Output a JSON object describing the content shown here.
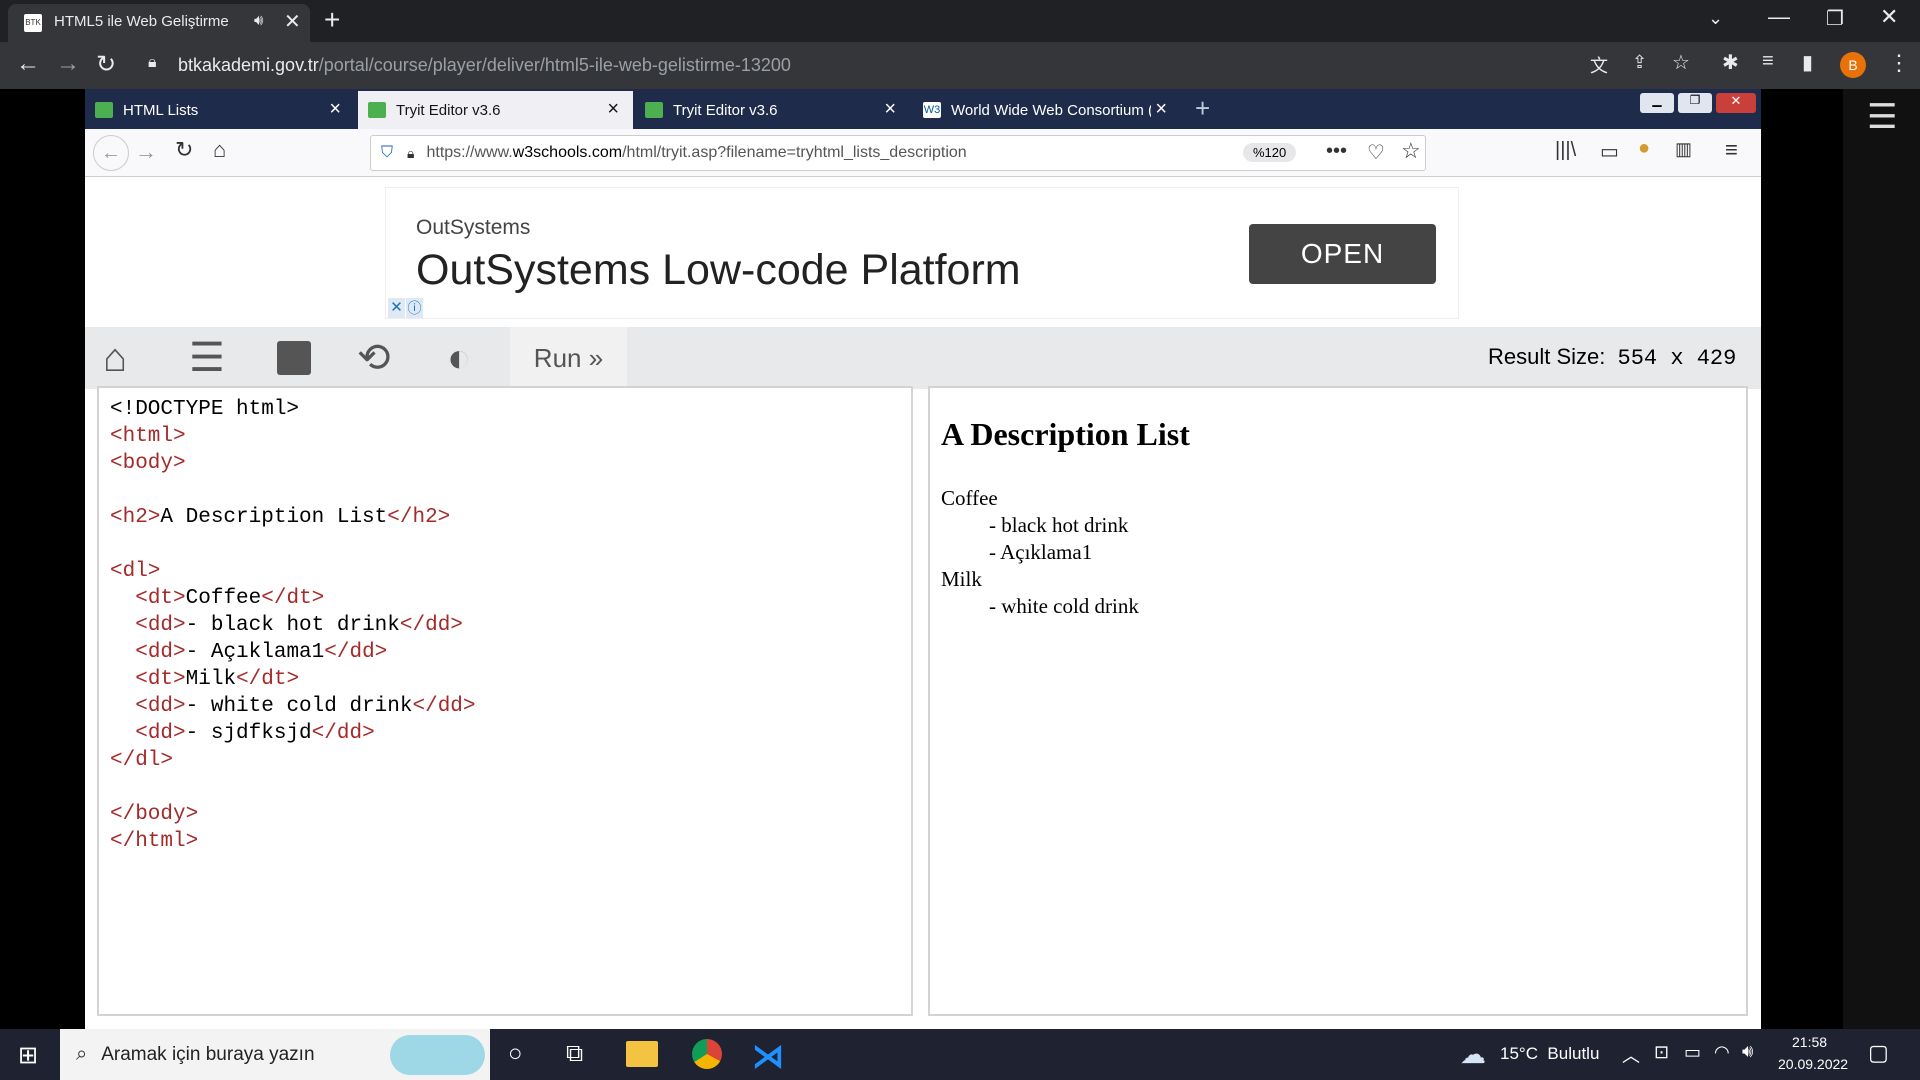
{
  "outer_browser": {
    "tab_title": "HTML5 ile Web Geliştirme",
    "url_host": "btkakademi.gov.tr",
    "url_path": "/portal/course/player/deliver/html5-ile-web-gelistirme-13200",
    "profile_initial": "B"
  },
  "inner_browser": {
    "tabs": [
      {
        "label": "HTML Lists"
      },
      {
        "label": "Tryit Editor v3.6"
      },
      {
        "label": "Tryit Editor v3.6"
      },
      {
        "label": "World Wide Web Consortium ("
      }
    ],
    "url_prefix": "https://www.",
    "url_domain": "w3schools.com",
    "url_rest": "/html/tryit.asp?filename=tryhtml_lists_description",
    "zoom": "%120"
  },
  "ad": {
    "brand": "OutSystems",
    "headline": "OutSystems Low-code Platform",
    "cta": "OPEN"
  },
  "editor": {
    "run_label": "Run »",
    "result_size_label": "Result Size:",
    "result_size_value": "554 x 429"
  },
  "code_lines": [
    "<!DOCTYPE html>",
    "<html>",
    "<body>",
    "",
    "<h2>A Description List</h2>",
    "",
    "<dl>",
    "  <dt>Coffee</dt>",
    "  <dd>- black hot drink</dd>",
    "  <dd>- Açıklama1</dd>",
    "  <dt>Milk</dt>",
    "  <dd>- white cold drink</dd>",
    "  <dd>- sjdfksjd</dd>",
    "</dl>",
    "",
    "</body>",
    "</html>"
  ],
  "result": {
    "heading": "A Description List",
    "items": [
      {
        "type": "dt",
        "text": "Coffee"
      },
      {
        "type": "dd",
        "text": "- black hot drink"
      },
      {
        "type": "dd",
        "text": "- Açıklama1"
      },
      {
        "type": "dt",
        "text": "Milk"
      },
      {
        "type": "dd",
        "text": "- white cold drink"
      }
    ]
  },
  "taskbar": {
    "search_placeholder": "Aramak için buraya yazın",
    "weather": "15°C  Bulutlu",
    "time": "21:58",
    "date": "20.09.2022"
  }
}
